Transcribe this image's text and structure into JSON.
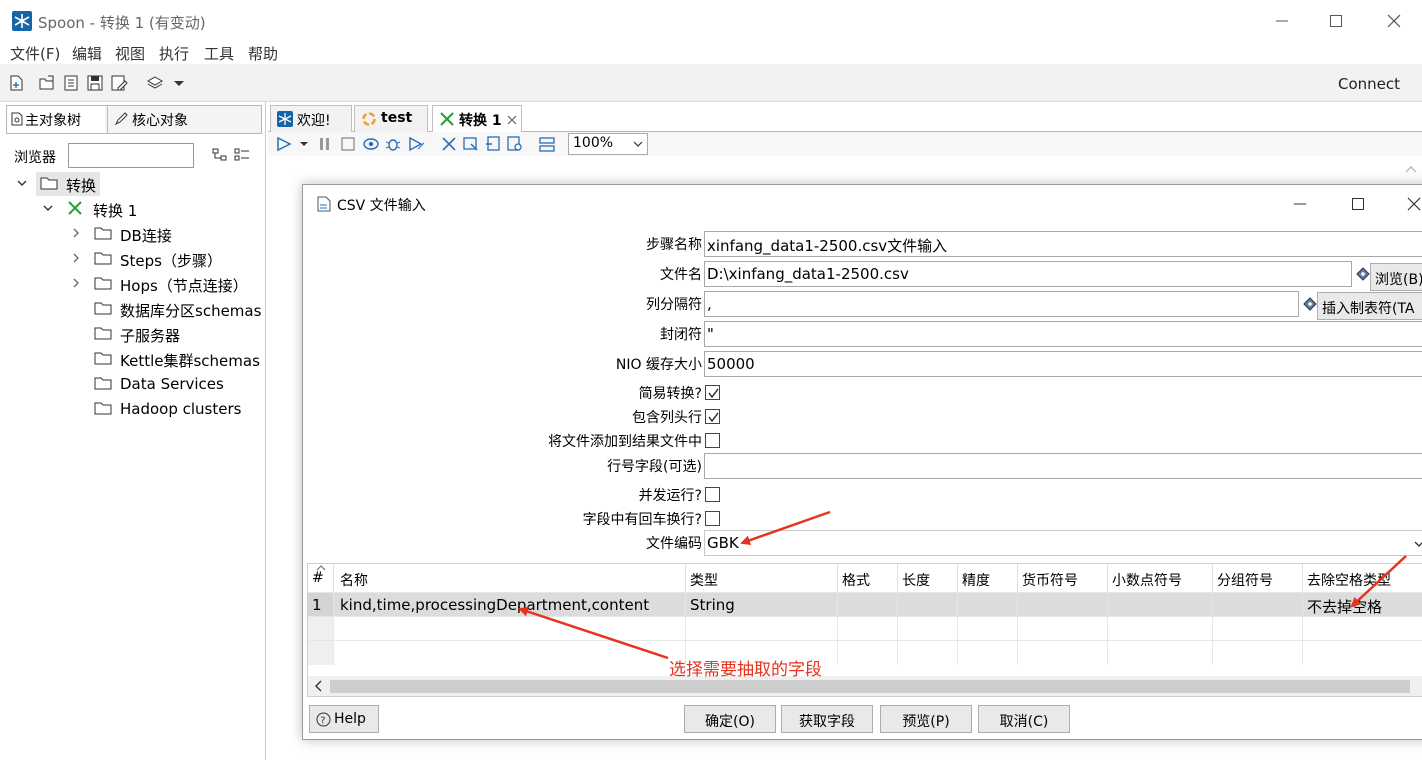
{
  "window": {
    "title": "Spoon - 转换 1 (有变动)"
  },
  "menu": [
    "文件(F)",
    "编辑",
    "视图",
    "执行",
    "工具",
    "帮助"
  ],
  "toolbar": {
    "connect_label": "Connect",
    "icons": [
      "new-file-icon",
      "open-icon",
      "explore-icon",
      "save-icon",
      "save-as-icon",
      "layers-icon"
    ]
  },
  "left_panel": {
    "tabs": [
      "主对象树",
      "核心对象"
    ],
    "browser_label": "浏览器",
    "browser_value": "",
    "tree": {
      "root": "转换",
      "child": "转换 1",
      "items": [
        "DB连接",
        "Steps（步骤）",
        "Hops（节点连接）",
        "数据库分区schemas",
        "子服务器",
        "Kettle集群schemas",
        "Data Services",
        "Hadoop clusters"
      ]
    }
  },
  "work_tabs": [
    {
      "label": "欢迎!"
    },
    {
      "label": "test"
    },
    {
      "label": "转换 1"
    }
  ],
  "run_toolbar": {
    "zoom": "100%"
  },
  "dialog": {
    "title": "CSV 文件输入",
    "fields": {
      "step_name_label": "步骤名称",
      "step_name_value": "xinfang_data1-2500.csv文件输入",
      "filename_label": "文件名",
      "filename_value": "D:\\xinfang_data1-2500.csv",
      "browse_button": "浏览(B)",
      "delimiter_label": "列分隔符",
      "delimiter_value": ",",
      "insert_tab_button": "插入制表符(TA",
      "enclosure_label": "封闭符",
      "enclosure_value": "\"",
      "nio_label": "NIO 缓存大小",
      "nio_value": "50000",
      "lazy_label": "简易转换?",
      "lazy_checked": true,
      "header_label": "包含列头行",
      "header_checked": true,
      "add_result_label": "将文件添加到结果文件中",
      "add_result_checked": false,
      "rownum_label": "行号字段(可选)",
      "rownum_value": "",
      "parallel_label": "并发运行?",
      "parallel_checked": false,
      "newline_label": "字段中有回车换行?",
      "newline_checked": false,
      "encoding_label": "文件编码",
      "encoding_value": "GBK"
    },
    "table": {
      "columns": [
        "#",
        "名称",
        "类型",
        "格式",
        "长度",
        "精度",
        "货币符号",
        "小数点符号",
        "分组符号",
        "去除空格类型"
      ],
      "rows": [
        [
          "1",
          "kind,time,processingDepartment,content",
          "String",
          "",
          "",
          "",
          "",
          "",
          "",
          "不去掉空格"
        ]
      ]
    },
    "buttons": {
      "help": "Help",
      "ok": "确定(O)",
      "get_fields": "获取字段",
      "preview": "预览(P)",
      "cancel": "取消(C)"
    }
  },
  "annotation": {
    "text": "选择需要抽取的字段",
    "color": "#e8321f"
  }
}
